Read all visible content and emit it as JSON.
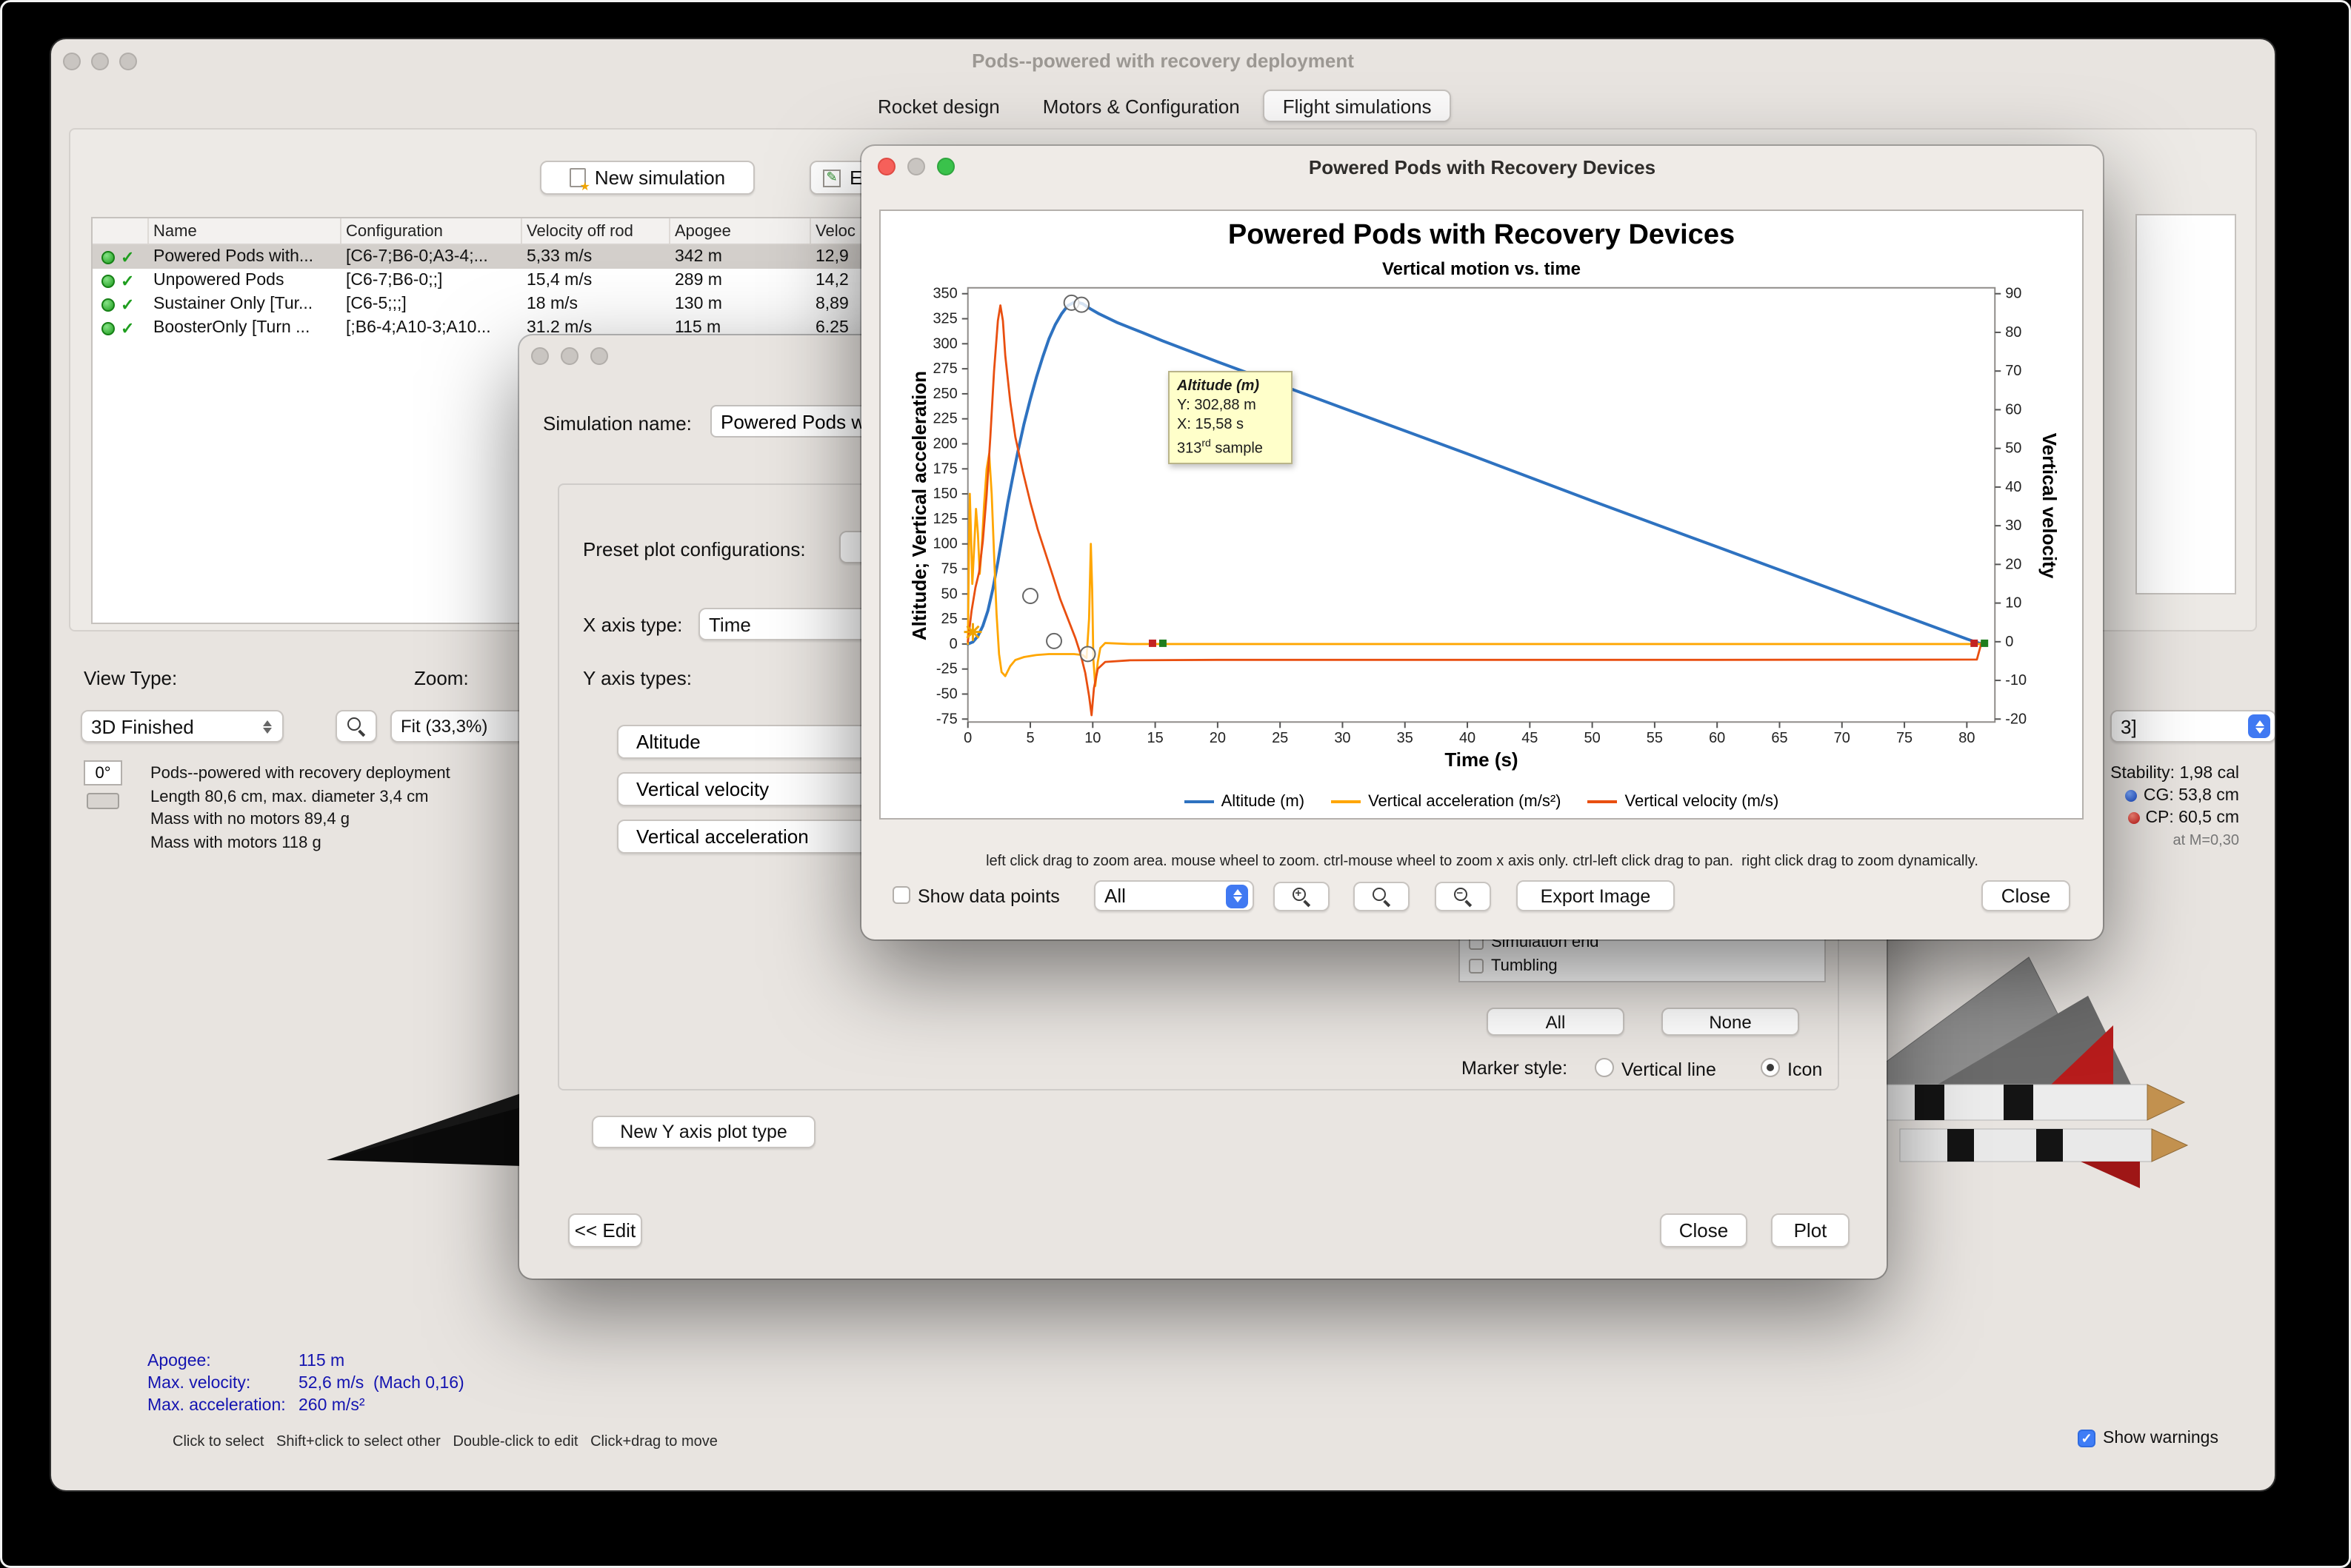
{
  "window": {
    "title": "Pods--powered with recovery deployment",
    "tabs": [
      {
        "label": "Rocket design"
      },
      {
        "label": "Motors & Configuration"
      },
      {
        "label": "Flight simulations"
      }
    ]
  },
  "toolbar": {
    "new_simulation": "New simulation",
    "edit_simulations": "Edit simulation"
  },
  "sim_table": {
    "columns": [
      "Name",
      "Configuration",
      "Velocity off rod",
      "Apogee",
      "Veloc"
    ],
    "rows": [
      {
        "name": "Powered Pods with...",
        "config": "[C6-7;B6-0;A3-4;...",
        "velocity_off_rod": "5,33 m/s",
        "apogee": "342 m",
        "velocity_deploy": "12,9",
        "selected": true
      },
      {
        "name": "Unpowered Pods",
        "config": "[C6-7;B6-0;;]",
        "velocity_off_rod": "15,4 m/s",
        "apogee": "289 m",
        "velocity_deploy": "14,2",
        "selected": false
      },
      {
        "name": "Sustainer Only [Tur...",
        "config": "[C6-5;;;]",
        "velocity_off_rod": "18 m/s",
        "apogee": "130 m",
        "velocity_deploy": "8,89",
        "selected": false
      },
      {
        "name": "BoosterOnly [Turn ...",
        "config": "[;B6-4;A10-3;A10...",
        "velocity_off_rod": "31.2 m/s",
        "apogee": "115 m",
        "velocity_deploy": "6.25",
        "selected": false
      }
    ]
  },
  "view_controls": {
    "view_type_label": "View Type:",
    "view_type_value": "3D Finished",
    "zoom_label": "Zoom:",
    "zoom_value": "Fit (33,3%)",
    "rotation_value": "0°"
  },
  "rocket_info": {
    "line1": "Pods--powered with recovery deployment",
    "line2": "Length 80,6 cm, max. diameter 3,4 cm",
    "line3": "Mass with no motors 89,4 g",
    "line4": "Mass with motors 118 g"
  },
  "flight_stats": {
    "apogee_label": "Apogee:",
    "apogee_value": "115 m",
    "max_velocity_label": "Max. velocity:",
    "max_velocity_value": "52,6 m/s  (Mach 0,16)",
    "max_acceleration_label": "Max. acceleration:",
    "max_acceleration_value": "260 m/s²"
  },
  "stability_panel": {
    "config_value": "3]",
    "stability": "Stability: 1,98 cal",
    "cg": "CG: 53,8 cm",
    "cp": "CP: 60,5 cm",
    "mach": "at M=0,30"
  },
  "status_bar": {
    "hints": "Click to select   Shift+click to select other   Double-click to edit   Click+drag to move",
    "show_warnings": "Show warnings"
  },
  "edit_dialog": {
    "simulation_name_label": "Simulation name:",
    "simulation_name_value": "Powered Pods with Recovery Devices",
    "preset_label": "Preset plot configurations:",
    "x_axis_label": "X axis type:",
    "x_axis_value": "Time",
    "y_axis_label": "Y axis types:",
    "y_axis_types": [
      "Altitude",
      "Vertical velocity",
      "Vertical acceleration"
    ],
    "events": [
      {
        "label": "Simulation end"
      },
      {
        "label": "Tumbling"
      }
    ],
    "all_button": "All",
    "none_button": "None",
    "marker_style_label": "Marker style:",
    "marker_vertical_line": "Vertical line",
    "marker_icon": "Icon",
    "new_y_axis_button": "New Y axis plot type",
    "edit_button": "<< Edit",
    "close_button": "Close",
    "plot_button": "Plot"
  },
  "plot_dialog": {
    "title": "Powered Pods with Recovery Devices",
    "help_text": "left click drag to zoom area. mouse wheel to zoom. ctrl-mouse wheel to zoom x axis only. ctrl-left click drag to pan.  right click drag to zoom dynamically.",
    "show_data_points": "Show data points",
    "events_dropdown": "All",
    "export_button": "Export Image",
    "close_button": "Close",
    "tooltip": {
      "title": "Altitude (m)",
      "y_line": "Y: 302,88 m",
      "x_line": "X: 15,58 s",
      "sample_number": "313",
      "sample_ordinal": "rd",
      "sample_word": "sample"
    }
  },
  "chart_data": {
    "type": "line",
    "title": "Powered Pods with Recovery Devices",
    "subtitle": "Vertical motion vs. time",
    "xlabel": "Time (s)",
    "ylabel_left": "Altitude; Vertical acceleration",
    "ylabel_right": "Vertical velocity",
    "xlim": [
      0,
      82.2
    ],
    "ylim_left": [
      -78,
      356
    ],
    "ylim_right": [
      -20.8,
      91.5
    ],
    "grid": false,
    "legend_position": "bottom",
    "x_ticks": [
      0,
      5,
      10,
      15,
      20,
      25,
      30,
      35,
      40,
      45,
      50,
      55,
      60,
      65,
      70,
      75,
      80
    ],
    "left_ticks": [
      350,
      325,
      300,
      275,
      250,
      225,
      200,
      175,
      150,
      125,
      100,
      75,
      50,
      25,
      0,
      -25,
      -50,
      -75
    ],
    "right_ticks": [
      90,
      80,
      70,
      60,
      50,
      40,
      30,
      20,
      10,
      0,
      -10,
      -20
    ],
    "series": [
      {
        "name": "Altitude (m)",
        "color": "#2e72c0",
        "axis": "left",
        "width": 2,
        "points": [
          [
            0,
            0
          ],
          [
            0.4,
            2
          ],
          [
            0.8,
            8
          ],
          [
            1.2,
            18
          ],
          [
            1.6,
            33
          ],
          [
            2,
            55
          ],
          [
            2.4,
            82
          ],
          [
            2.8,
            112
          ],
          [
            3.2,
            141
          ],
          [
            3.6,
            167
          ],
          [
            4,
            192
          ],
          [
            4.5,
            220
          ],
          [
            5,
            245
          ],
          [
            5.5,
            267
          ],
          [
            6,
            287
          ],
          [
            6.5,
            305
          ],
          [
            7,
            319
          ],
          [
            7.5,
            330
          ],
          [
            8,
            338
          ],
          [
            8.6,
            342
          ],
          [
            9.2,
            340
          ],
          [
            9.8,
            335
          ],
          [
            10.5,
            330
          ],
          [
            12,
            321
          ],
          [
            14,
            311
          ],
          [
            15.58,
            302.88
          ],
          [
            20,
            282
          ],
          [
            30,
            236
          ],
          [
            40,
            190
          ],
          [
            50,
            143
          ],
          [
            60,
            97
          ],
          [
            70,
            51
          ],
          [
            80,
            5
          ],
          [
            81.2,
            0
          ]
        ]
      },
      {
        "name": "Vertical acceleration (m/s²)",
        "color": "#ffa600",
        "axis": "left",
        "width": 1.4,
        "points": [
          [
            0,
            0
          ],
          [
            0.08,
            95
          ],
          [
            0.15,
            150
          ],
          [
            0.25,
            110
          ],
          [
            0.35,
            60
          ],
          [
            0.5,
            95
          ],
          [
            0.65,
            135
          ],
          [
            0.8,
            110
          ],
          [
            0.95,
            70
          ],
          [
            1.1,
            95
          ],
          [
            1.3,
            140
          ],
          [
            1.5,
            175
          ],
          [
            1.7,
            190
          ],
          [
            1.9,
            150
          ],
          [
            2.1,
            90
          ],
          [
            2.3,
            30
          ],
          [
            2.5,
            -10
          ],
          [
            2.7,
            -28
          ],
          [
            3,
            -32
          ],
          [
            3.4,
            -22
          ],
          [
            3.8,
            -16
          ],
          [
            4.5,
            -13
          ],
          [
            5.5,
            -11
          ],
          [
            6.5,
            -10
          ],
          [
            7.5,
            -10
          ],
          [
            8.5,
            -10
          ],
          [
            9.2,
            -11
          ],
          [
            9.5,
            -14
          ],
          [
            9.7,
            25
          ],
          [
            9.85,
            100
          ],
          [
            9.95,
            55
          ],
          [
            10.05,
            -15
          ],
          [
            10.2,
            -42
          ],
          [
            10.4,
            -18
          ],
          [
            10.6,
            -4
          ],
          [
            11,
            1
          ],
          [
            13,
            0
          ],
          [
            20,
            0
          ],
          [
            40,
            0
          ],
          [
            60,
            0
          ],
          [
            80,
            0
          ],
          [
            81.2,
            0
          ]
        ]
      },
      {
        "name": "Vertical velocity (m/s)",
        "color": "#e94f10",
        "axis": "right",
        "width": 1.4,
        "points": [
          [
            0,
            0
          ],
          [
            0.3,
            8
          ],
          [
            0.6,
            14
          ],
          [
            0.9,
            18
          ],
          [
            1.2,
            26
          ],
          [
            1.5,
            38
          ],
          [
            1.8,
            53
          ],
          [
            2.1,
            70
          ],
          [
            2.4,
            83
          ],
          [
            2.6,
            87
          ],
          [
            2.8,
            83
          ],
          [
            3,
            74
          ],
          [
            3.4,
            62
          ],
          [
            3.8,
            53
          ],
          [
            4.4,
            44
          ],
          [
            5,
            36
          ],
          [
            5.6,
            29
          ],
          [
            6.2,
            23
          ],
          [
            6.8,
            17
          ],
          [
            7.4,
            11
          ],
          [
            8,
            6
          ],
          [
            8.6,
            1
          ],
          [
            9,
            -3
          ],
          [
            9.4,
            -8
          ],
          [
            9.7,
            -14
          ],
          [
            9.9,
            -19
          ],
          [
            10.1,
            -12
          ],
          [
            10.4,
            -7
          ],
          [
            11,
            -5.2
          ],
          [
            13,
            -4.8
          ],
          [
            20,
            -4.7
          ],
          [
            40,
            -4.7
          ],
          [
            60,
            -4.7
          ],
          [
            80.8,
            -4.6
          ],
          [
            81.2,
            0
          ]
        ]
      }
    ],
    "markers": [
      {
        "shape": "circle",
        "t": 8.3,
        "v": 341
      },
      {
        "shape": "circle",
        "t": 9.1,
        "v": 339
      },
      {
        "shape": "circle",
        "t": 5.0,
        "v": 48
      },
      {
        "shape": "circle",
        "t": 6.9,
        "v": 3
      },
      {
        "shape": "circle",
        "t": 9.6,
        "v": -10
      },
      {
        "shape": "burst",
        "t": 0.4,
        "v": 12
      },
      {
        "shape": "flag",
        "t": 15.2,
        "v": 0
      },
      {
        "shape": "flag",
        "t": 81,
        "v": 0
      }
    ]
  }
}
